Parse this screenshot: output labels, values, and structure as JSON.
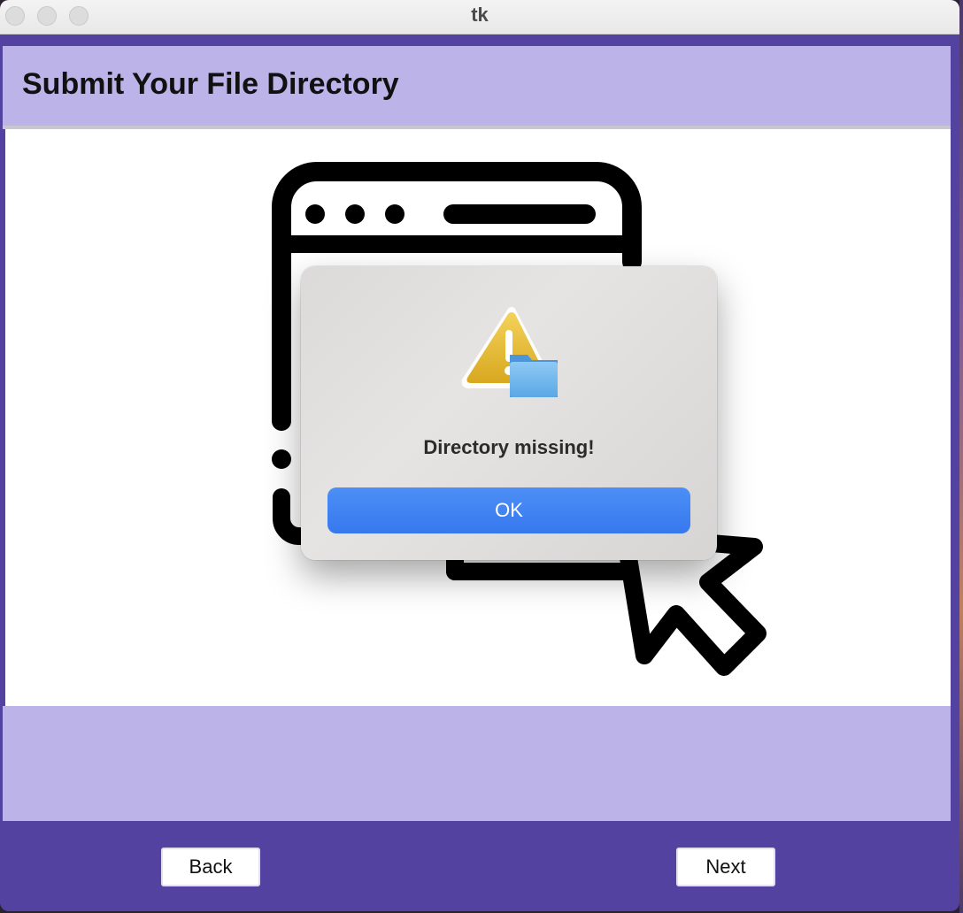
{
  "window": {
    "title": "tk"
  },
  "header": {
    "title": "Submit Your File Directory"
  },
  "illustration": {
    "icon": "browser-window-with-cursor-icon"
  },
  "dialog": {
    "icon": "warning-folder-icon",
    "message": "Directory missing!",
    "ok_label": "OK"
  },
  "footer": {
    "back_label": "Back",
    "next_label": "Next"
  },
  "colors": {
    "header_bg": "#bcb4e8",
    "footer_bg": "#5442a1",
    "ok_button": "#3b7cf0"
  }
}
